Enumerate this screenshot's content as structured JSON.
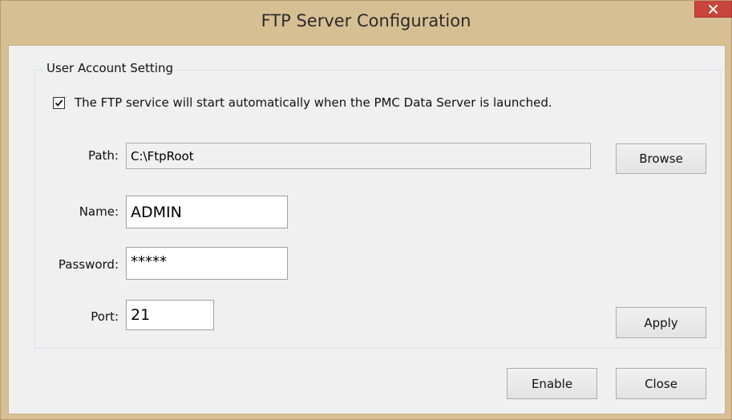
{
  "window": {
    "title": "FTP Server Configuration"
  },
  "group": {
    "legend": "User Account Setting",
    "autostart": {
      "checked": true,
      "label": "The FTP service will start automatically when the PMC Data Server is launched."
    },
    "path": {
      "label": "Path:",
      "value": "C:\\FtpRoot",
      "browse_label": "Browse"
    },
    "name": {
      "label": "Name:",
      "value": "ADMIN"
    },
    "password": {
      "label": "Password:",
      "value": "*****"
    },
    "port": {
      "label": "Port:",
      "value": "21"
    },
    "apply_label": "Apply"
  },
  "footer": {
    "enable_label": "Enable",
    "close_label": "Close"
  },
  "colors": {
    "frame": "#d7bf94",
    "close_button": "#c7453b",
    "client_background": "#f0f0f0"
  },
  "icons": {
    "close": "close-icon",
    "check": "checkmark-icon"
  }
}
